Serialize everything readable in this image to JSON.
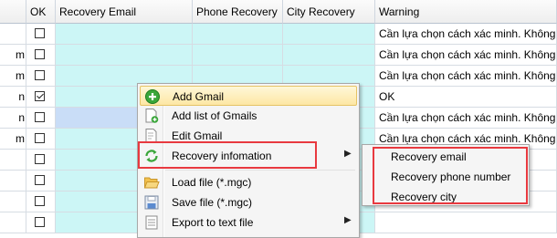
{
  "columns": [
    "",
    "OK",
    "Recovery Email",
    "Phone Recovery",
    "City Recovery",
    "Warning"
  ],
  "rows": [
    {
      "left": "",
      "ok": false,
      "warning": "Cần lựa chọn cách xác minh. Không"
    },
    {
      "left": "m",
      "ok": false,
      "warning": "Cần lựa chọn cách xác minh. Không"
    },
    {
      "left": "m",
      "ok": false,
      "warning": "Cần lựa chọn cách xác minh. Không"
    },
    {
      "left": "n",
      "ok": true,
      "warning": "OK"
    },
    {
      "left": "n",
      "ok": false,
      "warning": "Cần lựa chọn cách xác minh. Không"
    },
    {
      "left": "m",
      "ok": false,
      "warning": "Cần lựa chọn cách xác minh. Không"
    },
    {
      "left": "",
      "ok": false,
      "warning": ""
    },
    {
      "left": "",
      "ok": false,
      "warning": ""
    },
    {
      "left": "",
      "ok": false,
      "warning": ""
    },
    {
      "left": "",
      "ok": false,
      "warning": ""
    }
  ],
  "context_menu": {
    "items": [
      {
        "label": "Add Gmail",
        "icon": "add-circle-icon"
      },
      {
        "label": "Add list of Gmails",
        "icon": "document-add-icon"
      },
      {
        "label": "Edit Gmail",
        "icon": "document-edit-icon"
      },
      {
        "label": "Recovery infomation",
        "icon": "refresh-arrows-icon"
      },
      {
        "label": "Load file (*.mgc)",
        "icon": "folder-open-icon"
      },
      {
        "label": "Save file (*.mgc)",
        "icon": "save-disk-icon"
      },
      {
        "label": "Export to text file",
        "icon": "export-text-icon"
      }
    ]
  },
  "submenu": {
    "items": [
      "Recovery email",
      "Recovery phone number",
      "Recovery city"
    ]
  },
  "colors": {
    "recovery_cell_bg": "#ccf6f6",
    "highlight_box": "#e8393f",
    "menu_hover": "#fde7a4"
  }
}
